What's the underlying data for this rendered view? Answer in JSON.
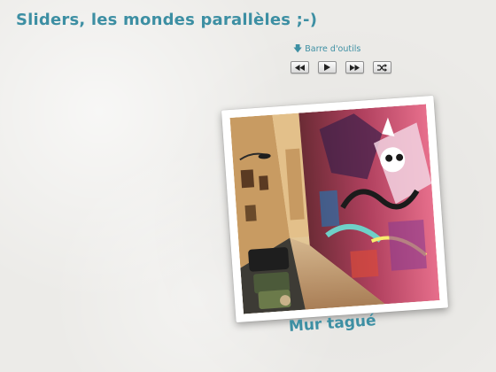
{
  "header": {
    "title": "Sliders, les mondes parallèles ;-)"
  },
  "toolbar": {
    "toggle_label": "Barre d'outils",
    "toggle_icon": "arrow-down-icon",
    "buttons": [
      {
        "name": "previous",
        "icon": "rewind-icon"
      },
      {
        "name": "play",
        "icon": "play-icon"
      },
      {
        "name": "next",
        "icon": "fast-forward-icon"
      },
      {
        "name": "shuffle",
        "icon": "shuffle-icon"
      }
    ]
  },
  "slide": {
    "caption": "Mur tagué"
  },
  "colors": {
    "accent": "#3d8fa3",
    "background": "#ecebe8",
    "frame": "#ffffff"
  }
}
